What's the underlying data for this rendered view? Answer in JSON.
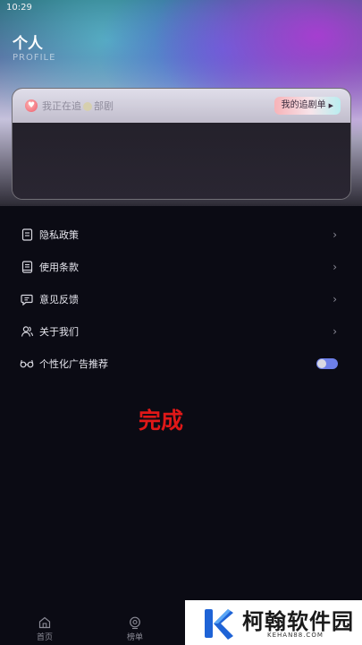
{
  "status_bar": {
    "time": "10:29"
  },
  "header": {
    "title": "个人",
    "subtitle": "PROFILE"
  },
  "watching_card": {
    "text_prefix": "我正在追",
    "text_suffix": "部剧",
    "button_label": "我的追剧单"
  },
  "menu": {
    "items": [
      {
        "label": "隐私政策",
        "icon": "document-icon"
      },
      {
        "label": "使用条款",
        "icon": "book-icon"
      },
      {
        "label": "意见反馈",
        "icon": "feedback-icon"
      },
      {
        "label": "关于我们",
        "icon": "users-icon"
      },
      {
        "label": "个性化广告推荐",
        "icon": "glasses-icon",
        "toggle_on": true
      }
    ]
  },
  "overlay_text": "完成",
  "tabbar": {
    "tabs": [
      {
        "label": "首页",
        "icon": "home-icon"
      },
      {
        "label": "榜单",
        "icon": "ranking-icon"
      }
    ]
  },
  "watermark": {
    "title": "柯翰软件园",
    "subtitle": "KEHAN88.COM"
  },
  "colors": {
    "accent": "#6d7fe8",
    "overlay_red": "#e01818",
    "background": "#0b0b14"
  }
}
